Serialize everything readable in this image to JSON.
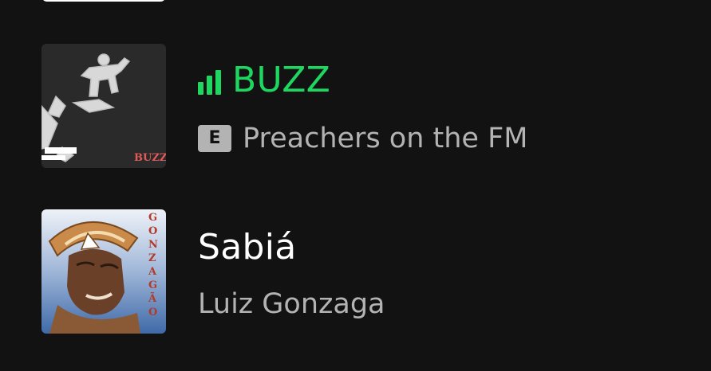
{
  "tracks": [
    {
      "title": "BUZZ",
      "artist": "Preachers on the FM",
      "explicit_label": "E",
      "now_playing": true,
      "cover_text": "BUZZ",
      "title_color": "#1ed760"
    },
    {
      "title": "Sabiá",
      "artist": "Luiz Gonzaga",
      "explicit_label": "",
      "now_playing": false,
      "cover_text": "GONZAGÃO",
      "title_color": "#ffffff"
    }
  ],
  "colors": {
    "background": "#121212",
    "accent": "#1ed760",
    "secondary_text": "#b3b3b3"
  },
  "icons": {
    "now_playing": "equalizer-bars-icon",
    "explicit": "explicit-badge-icon"
  }
}
